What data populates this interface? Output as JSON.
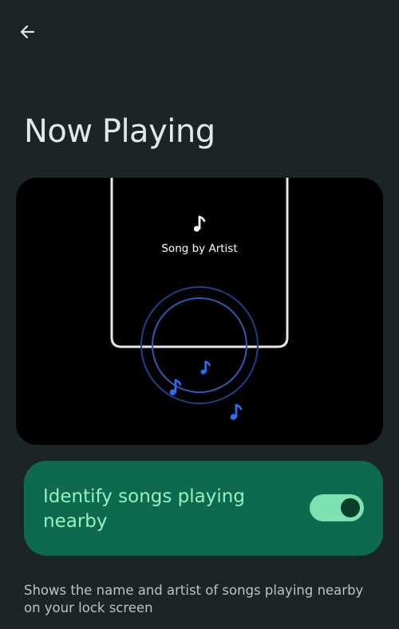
{
  "header": {
    "back_icon": "arrow-back-icon",
    "title": "Now Playing"
  },
  "illustration": {
    "note_icon": "music-note-icon",
    "song_label": "Song by Artist",
    "accent_color": "#2e6ff0"
  },
  "toggle": {
    "label": "Identify songs playing nearby",
    "state": true,
    "track_color": "#7de2b0",
    "card_color": "#0e6a4f"
  },
  "description": "Shows the name and artist of songs playing nearby on your lock screen"
}
